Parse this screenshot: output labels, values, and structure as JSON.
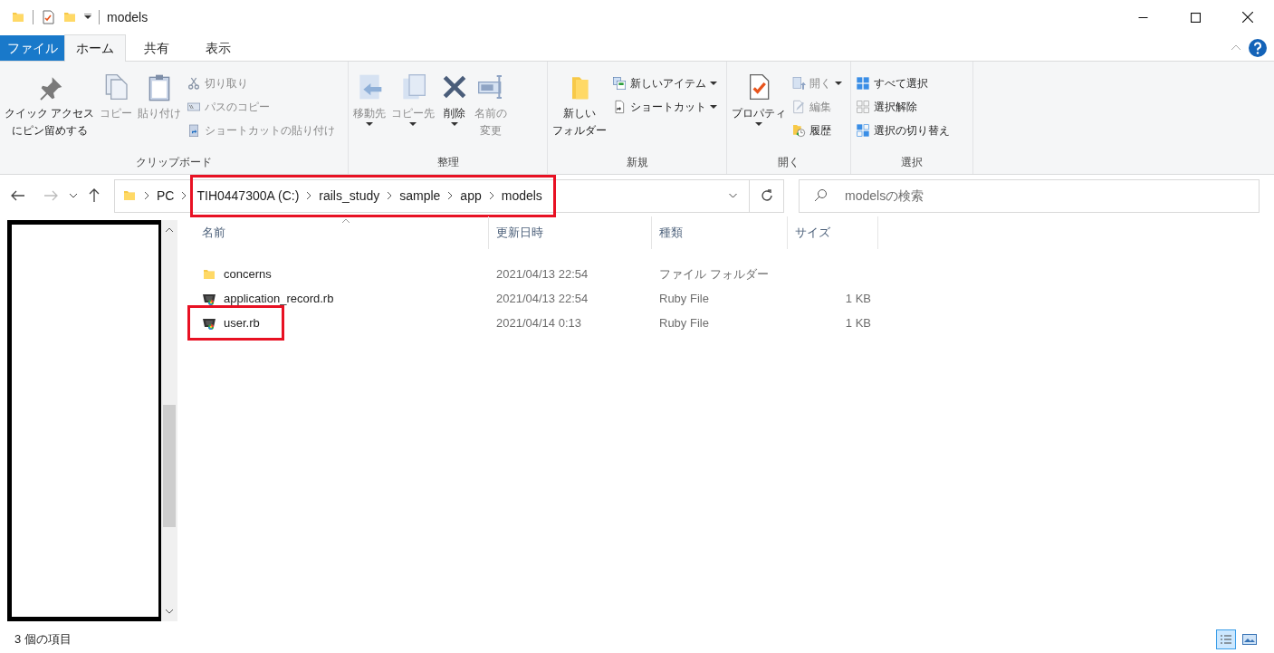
{
  "title_bar": {
    "title": "models"
  },
  "ribbon_tabs": [
    {
      "label": "ファイル",
      "kind": "file",
      "selected": false
    },
    {
      "label": "ホーム",
      "kind": "tab",
      "selected": true
    },
    {
      "label": "共有",
      "kind": "tab",
      "selected": false
    },
    {
      "label": "表示",
      "kind": "tab",
      "selected": false
    }
  ],
  "ribbon_groups": [
    {
      "label": "クリップボード",
      "items": [
        {
          "label_lines": [
            "クイック アクセス",
            "にピン留めする"
          ],
          "kind": "large",
          "disabled": false,
          "dropdown": false
        },
        {
          "label": "コピー",
          "kind": "large",
          "disabled": true,
          "dropdown": false
        },
        {
          "label": "貼り付け",
          "kind": "large",
          "disabled": true,
          "dropdown": false
        },
        {
          "label": "切り取り",
          "kind": "small",
          "disabled": true,
          "dropdown": false
        },
        {
          "label": "パスのコピー",
          "kind": "small",
          "disabled": true,
          "dropdown": false
        },
        {
          "label": "ショートカットの貼り付け",
          "kind": "small",
          "disabled": true,
          "dropdown": false
        }
      ]
    },
    {
      "label": "整理",
      "items": [
        {
          "label": "移動先",
          "kind": "large",
          "disabled": true,
          "dropdown": true
        },
        {
          "label": "コピー先",
          "kind": "large",
          "disabled": true,
          "dropdown": true
        },
        {
          "label": "削除",
          "kind": "large",
          "disabled": false,
          "dropdown": true
        },
        {
          "label_lines": [
            "名前の",
            "変更"
          ],
          "kind": "large",
          "disabled": true,
          "dropdown": false
        }
      ]
    },
    {
      "label": "新規",
      "items": [
        {
          "label_lines": [
            "新しい",
            "フォルダー"
          ],
          "kind": "large",
          "disabled": false,
          "dropdown": false
        },
        {
          "label": "新しいアイテム",
          "kind": "small",
          "disabled": false,
          "dropdown": true
        },
        {
          "label": "ショートカット",
          "kind": "small",
          "disabled": false,
          "dropdown": true
        }
      ]
    },
    {
      "label": "開く",
      "items": [
        {
          "label": "プロパティ",
          "kind": "large",
          "disabled": false,
          "dropdown": true
        },
        {
          "label": "開く",
          "kind": "small",
          "disabled": true,
          "dropdown": true
        },
        {
          "label": "編集",
          "kind": "small",
          "disabled": true,
          "dropdown": false
        },
        {
          "label": "履歴",
          "kind": "small",
          "disabled": false,
          "dropdown": false
        }
      ]
    },
    {
      "label": "選択",
      "items": [
        {
          "label": "すべて選択",
          "kind": "small",
          "disabled": false,
          "dropdown": false
        },
        {
          "label": "選択解除",
          "kind": "small",
          "disabled": false,
          "dropdown": false
        },
        {
          "label": "選択の切り替え",
          "kind": "small",
          "disabled": false,
          "dropdown": false
        }
      ]
    }
  ],
  "address_bar": {
    "breadcrumbs": [
      {
        "label": "PC",
        "highlighted": false
      },
      {
        "label": "TIH0447300A (C:)",
        "highlighted": true
      },
      {
        "label": "rails_study",
        "highlighted": true
      },
      {
        "label": "sample",
        "highlighted": true
      },
      {
        "label": "app",
        "highlighted": true
      },
      {
        "label": "models",
        "highlighted": true
      }
    ]
  },
  "search": {
    "placeholder": "modelsの検索"
  },
  "file_list": {
    "columns": [
      {
        "label": "名前",
        "sorted": true
      },
      {
        "label": "更新日時",
        "sorted": false
      },
      {
        "label": "種類",
        "sorted": false
      },
      {
        "label": "サイズ",
        "sorted": false
      }
    ],
    "rows": [
      {
        "name": "concerns",
        "modified": "2021/04/13 22:54",
        "type": "ファイル フォルダー",
        "kind": "folder",
        "highlighted": false
      },
      {
        "name": "application_record.rb",
        "modified": "2021/04/13 22:54",
        "type": "Ruby File",
        "size": "1 KB",
        "kind": "ruby",
        "highlighted": false
      },
      {
        "name": "user.rb",
        "modified": "2021/04/14 0:13",
        "type": "Ruby File",
        "size": "1 KB",
        "kind": "ruby",
        "highlighted": true
      }
    ]
  },
  "status_bar": {
    "text": "3 個の項目",
    "views": [
      {
        "kind": "details",
        "selected": true
      },
      {
        "kind": "large_icons",
        "selected": false
      }
    ]
  }
}
